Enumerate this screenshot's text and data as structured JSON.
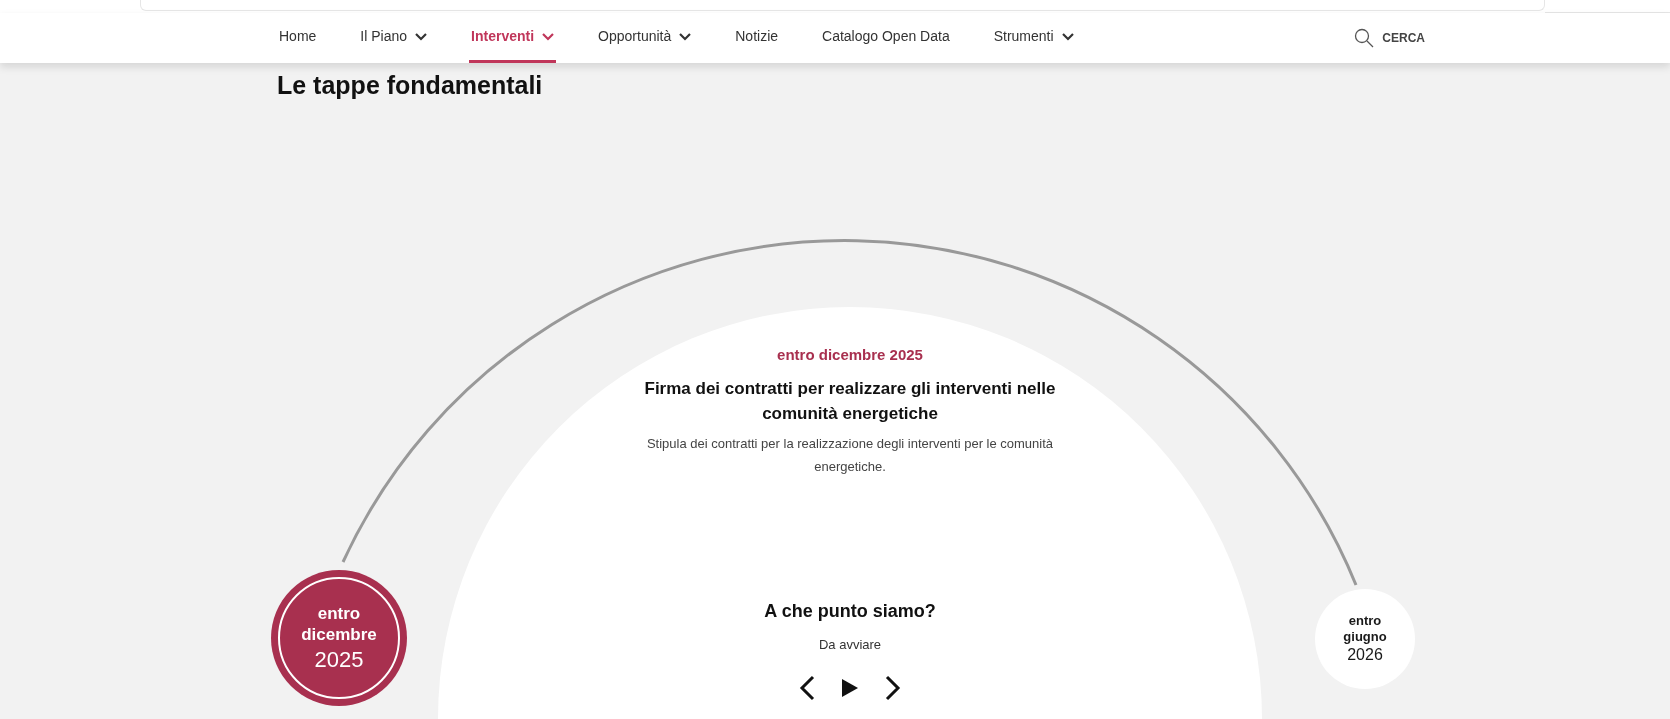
{
  "nav": {
    "items": [
      {
        "label": "Home",
        "selected": false,
        "dropdown": false
      },
      {
        "label": "Il Piano",
        "selected": false,
        "dropdown": true
      },
      {
        "label": "Interventi",
        "selected": true,
        "dropdown": true
      },
      {
        "label": "Opportunità",
        "selected": false,
        "dropdown": true
      },
      {
        "label": "Notizie",
        "selected": false,
        "dropdown": false
      },
      {
        "label": "Catalogo Open Data",
        "selected": false,
        "dropdown": false
      },
      {
        "label": "Strumenti",
        "selected": false,
        "dropdown": true
      }
    ],
    "search": {
      "label": "CERCA"
    }
  },
  "section": {
    "title": "Le tappe fondamentali",
    "milestones": [
      {
        "line1": "entro",
        "line2": "dicembre",
        "year": "2025",
        "selected": true
      },
      {
        "line1": "entro",
        "line2": "giugno",
        "year": "2026",
        "selected": false
      }
    ],
    "current": {
      "date": "entro dicembre 2025",
      "title": "Firma dei contratti per realizzare gli interventi nelle comunità energetiche",
      "description": "Stipula dei contratti per la realizzazione degli interventi per le comunità energetiche."
    },
    "status": {
      "heading": "A che punto siamo?",
      "value": "Da avviare"
    }
  }
}
